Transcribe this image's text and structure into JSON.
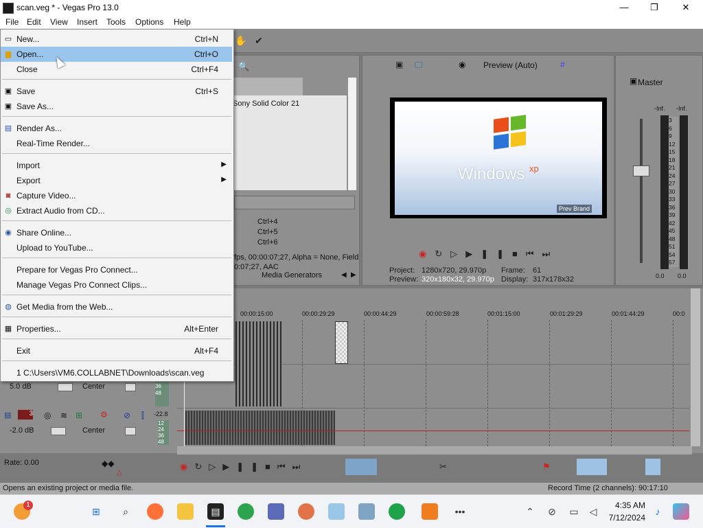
{
  "window": {
    "title": "scan.veg * - Vegas Pro 13.0",
    "minimize": "—",
    "maximize": "❐",
    "close": "✕"
  },
  "menubar": [
    "File",
    "Edit",
    "View",
    "Insert",
    "Tools",
    "Options",
    "Help"
  ],
  "file_menu": [
    {
      "label": "New...",
      "shortcut": "Ctrl+N",
      "icon": "new-file-icon"
    },
    {
      "label": "Open...",
      "shortcut": "Ctrl+O",
      "icon": "folder-open-icon",
      "highlighted": true
    },
    {
      "label": "Close",
      "shortcut": "Ctrl+F4",
      "icon": ""
    },
    {
      "label": "Save",
      "shortcut": "Ctrl+S",
      "icon": "floppy-disk-icon"
    },
    {
      "label": "Save As...",
      "shortcut": "",
      "icon": "save-as-icon"
    },
    {
      "label": "Render As...",
      "shortcut": "",
      "icon": "render-icon"
    },
    {
      "label": "Real-Time Render...",
      "shortcut": "",
      "icon": ""
    },
    {
      "label": "Import",
      "shortcut": "",
      "icon": "",
      "submenu": true
    },
    {
      "label": "Export",
      "shortcut": "",
      "icon": "",
      "submenu": true
    },
    {
      "label": "Capture Video...",
      "shortcut": "",
      "icon": "capture-icon"
    },
    {
      "label": "Extract Audio from CD...",
      "shortcut": "",
      "icon": "cd-icon"
    },
    {
      "label": "Share Online...",
      "shortcut": "",
      "icon": "share-icon"
    },
    {
      "label": "Upload to YouTube...",
      "shortcut": "",
      "icon": "youtube-icon"
    },
    {
      "label": "Prepare for Vegas Pro Connect...",
      "shortcut": "",
      "icon": ""
    },
    {
      "label": "Manage Vegas Pro Connect Clips...",
      "shortcut": "",
      "icon": ""
    },
    {
      "label": "Get Media from the Web...",
      "shortcut": "",
      "icon": "web-icon"
    },
    {
      "label": "Properties...",
      "shortcut": "Alt+Enter",
      "icon": "properties-icon"
    },
    {
      "label": "Exit",
      "shortcut": "Alt+F4",
      "icon": ""
    },
    {
      "label": "1 C:\\Users\\VM6.COLLABNET\\Downloads\\scan.veg",
      "shortcut": "",
      "icon": ""
    }
  ],
  "media_panel": {
    "item": "Sony Solid Color 21",
    "shortcuts": [
      "Ctrl+4",
      "Ctrl+5",
      "Ctrl+6"
    ],
    "info_line1": "fps, 00:00:07;27, Alpha = None, Field",
    "info_line2": "0:07;27, AAC",
    "tab": "Media Generators"
  },
  "preview": {
    "mode": "Preview (Auto)",
    "brand_text": "Windows",
    "brand_sub": "xp",
    "corner_text": "Prev Brand",
    "project_label": "Project:",
    "project_value": "1280x720, 29.970p",
    "preview_label": "Preview:",
    "preview_value": "320x180x32, 29.970p",
    "frame_label": "Frame:",
    "frame_value": "61",
    "display_label": "Display:",
    "display_value": "317x178x32"
  },
  "master": {
    "label": "Master",
    "left_peak": "-Inf.",
    "right_peak": "-Inf.",
    "scale": [
      "3",
      "6",
      "9",
      "12",
      "15",
      "18",
      "21",
      "24",
      "27",
      "30",
      "33",
      "36",
      "39",
      "42",
      "45",
      "48",
      "51",
      "54",
      "57"
    ],
    "left_value": "0.0",
    "right_value": "0.0"
  },
  "timeline": {
    "ticks": [
      "00:00:15:00",
      "00:00:29:29",
      "00:00:44:29",
      "00:00:59:28",
      "00:01:15:00",
      "00:01:29:29",
      "00:01:44:29",
      "00:0"
    ],
    "track1_volume": "5.0 dB",
    "track1_pan": "Center",
    "track2_number": "3",
    "track2_volume": "-2.0 dB",
    "track2_pan": "Center",
    "track2_meter_top": "-22.8",
    "mini_meter_1": [
      "24",
      "36",
      "48"
    ],
    "mini_meter_2": [
      "12",
      "24",
      "36",
      "48"
    ]
  },
  "transport": {
    "rate": "Rate: 0.00"
  },
  "status": {
    "left": "Opens an existing project or media file.",
    "right": "Record Time (2 channels): 90:17:10"
  },
  "taskbar": {
    "time": "4:35 AM",
    "date": "7/12/2024",
    "notification_badge": "1",
    "overflow": "•••"
  },
  "colors": {
    "accent": "#99c5ec",
    "panel": "#8e8e8e",
    "timeline_red": "#b22222"
  }
}
